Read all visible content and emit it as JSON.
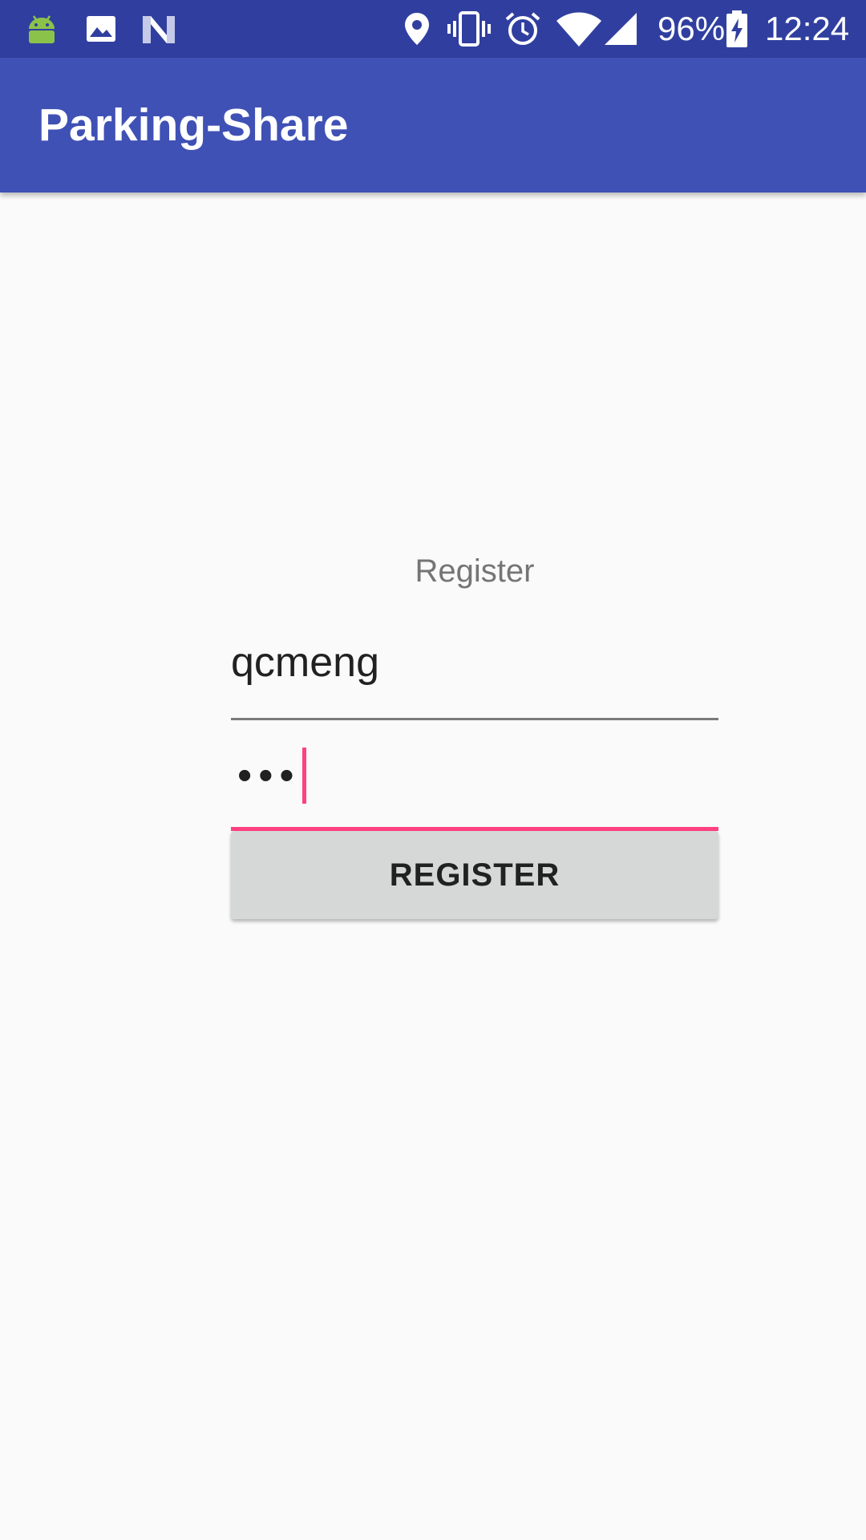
{
  "status_bar": {
    "battery_percent": "96%",
    "time": "12:24",
    "icons": [
      "android-icon",
      "image-icon",
      "n-logo-icon",
      "location-icon",
      "vibrate-icon",
      "alarm-icon",
      "wifi-icon",
      "cell-signal-icon",
      "battery-charging-icon"
    ]
  },
  "app_bar": {
    "title": "Parking-Share"
  },
  "form": {
    "heading": "Register",
    "username_value": "qcmeng",
    "password_value": "•••",
    "register_button_label": "REGISTER"
  },
  "colors": {
    "status_bar": "#303f9f",
    "app_bar": "#3f51b5",
    "accent": "#ff4081",
    "background": "#fafafa",
    "button": "#d6d7d7"
  }
}
